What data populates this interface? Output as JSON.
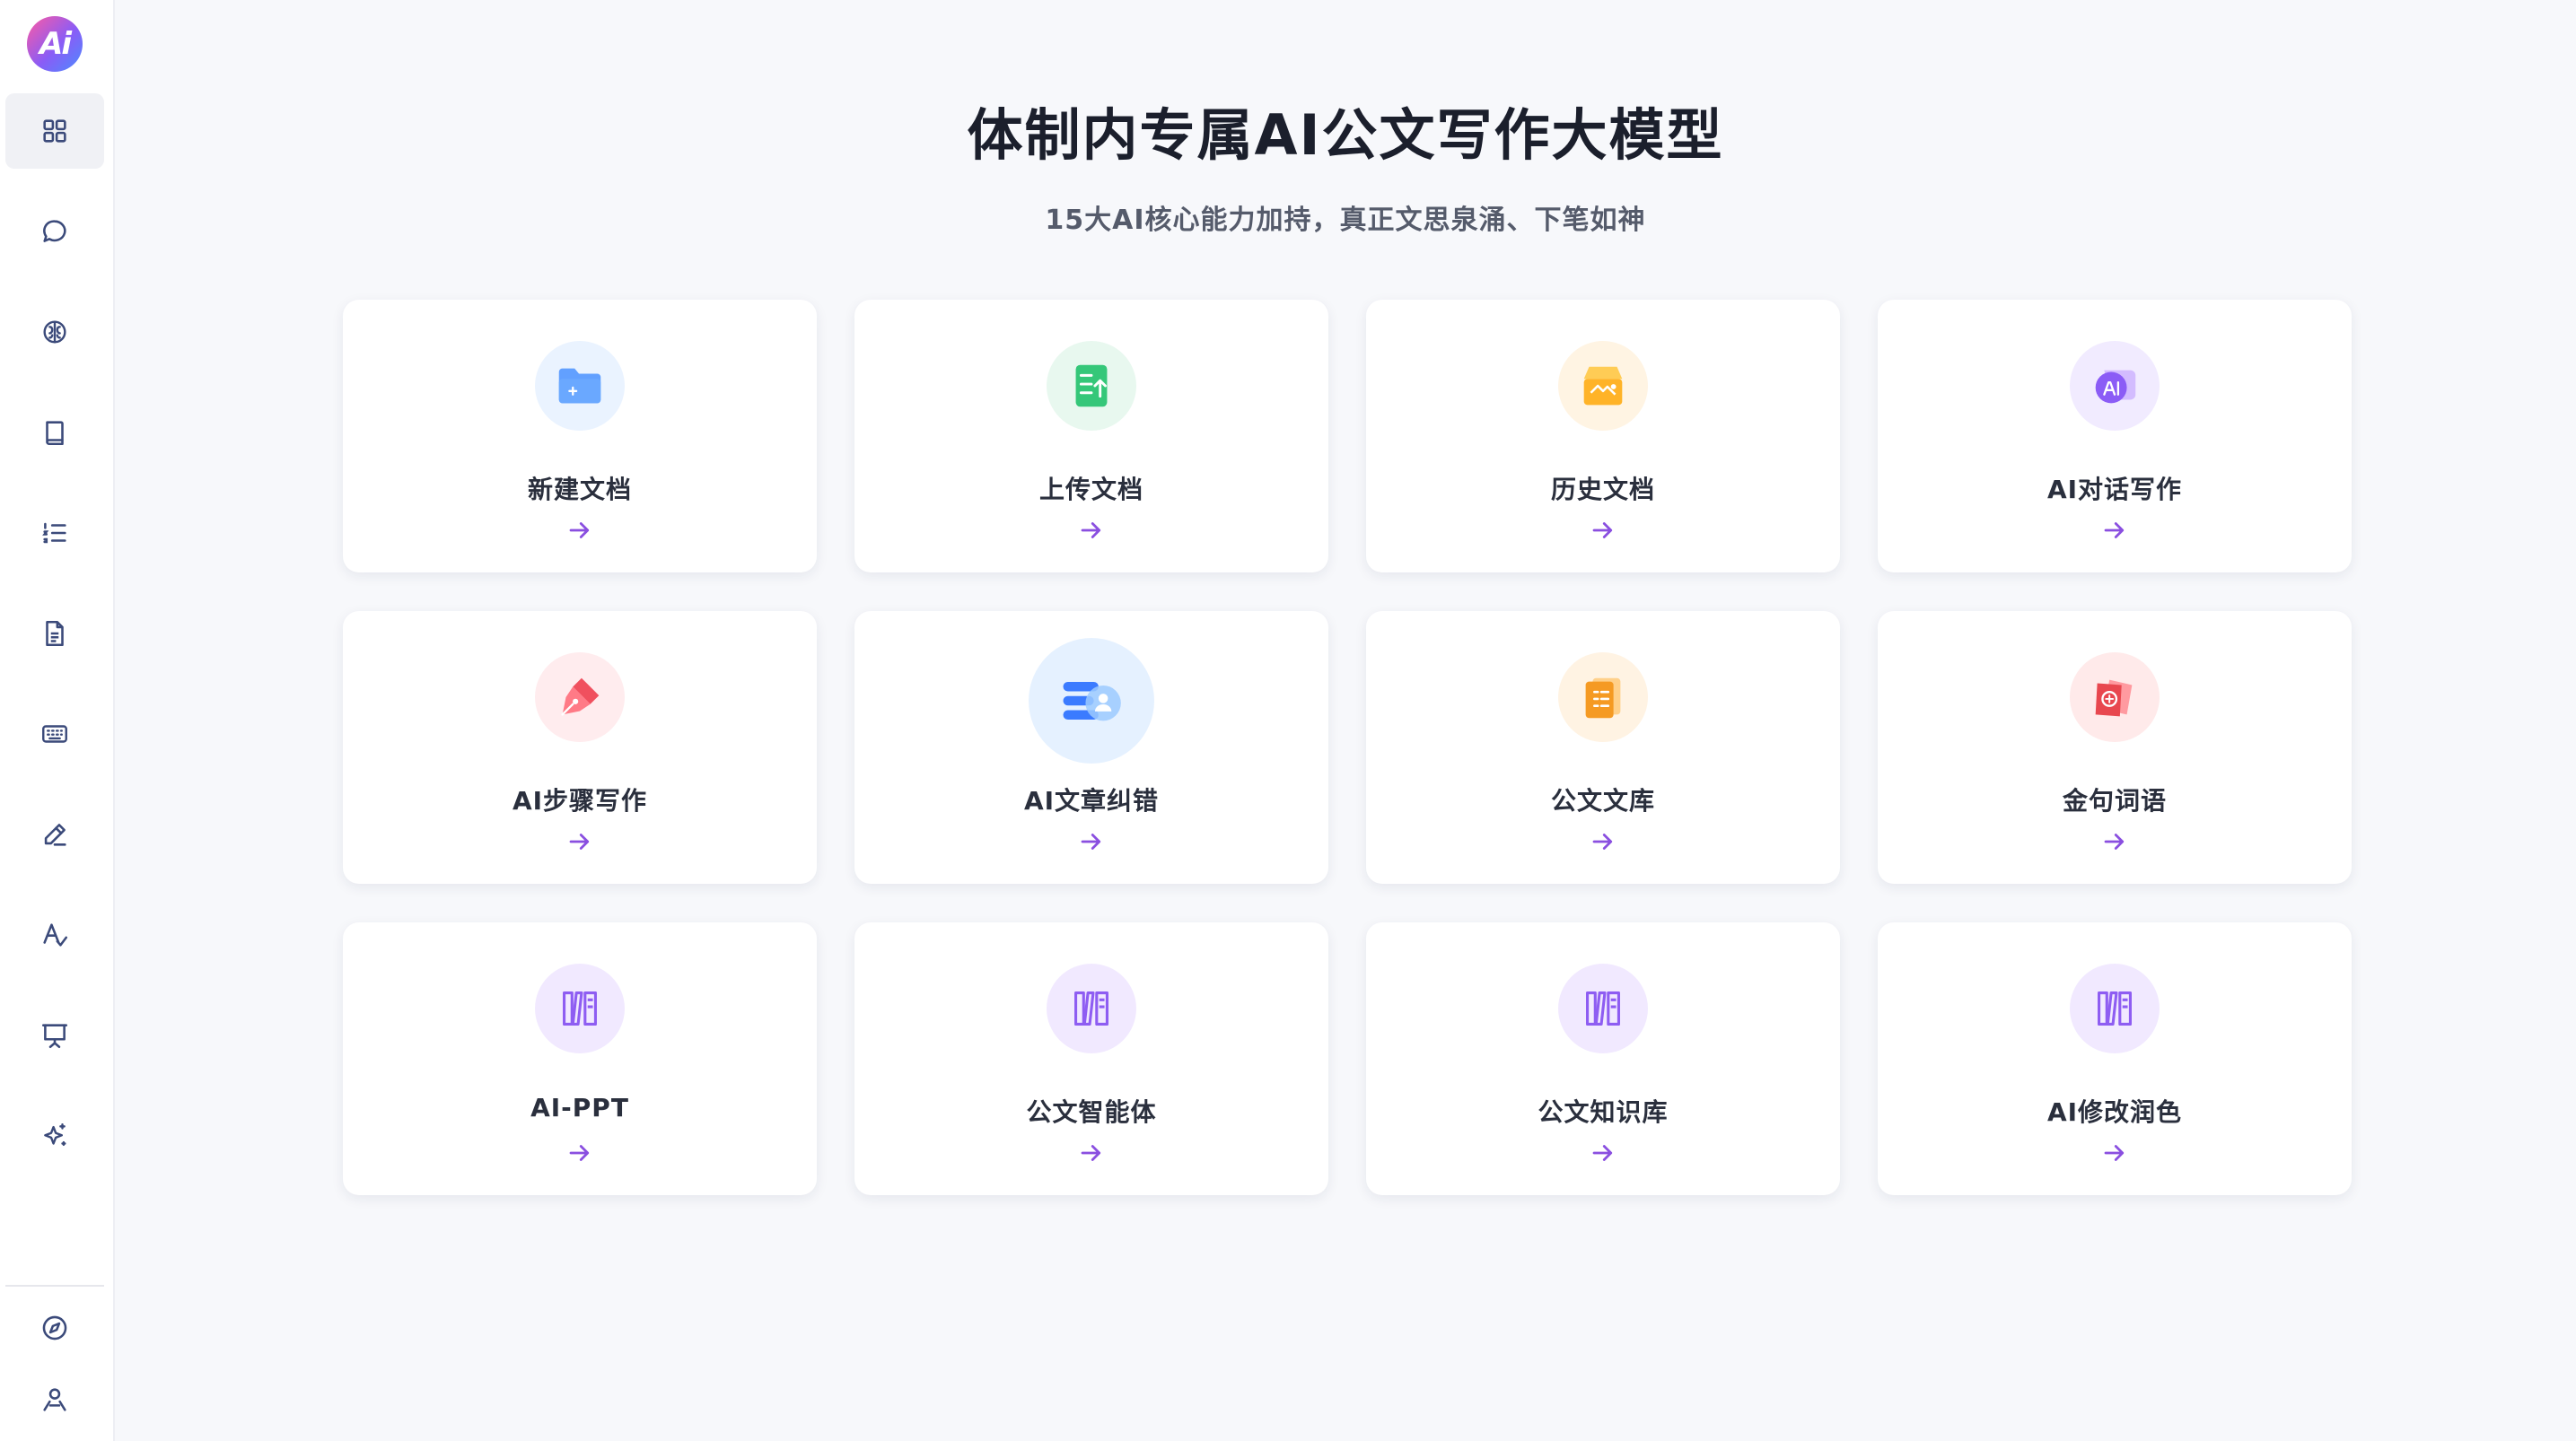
{
  "header": {
    "title": "体制内专属AI公文写作大模型",
    "subtitle": "15大AI核心能力加持，真正文思泉涌、下笔如神"
  },
  "sidebar": {
    "logo_text": "Ai",
    "items": [
      {
        "icon": "grid-icon",
        "active": true
      },
      {
        "icon": "chat-icon"
      },
      {
        "icon": "brain-icon"
      },
      {
        "icon": "book-icon"
      },
      {
        "icon": "list-icon"
      },
      {
        "icon": "document-icon"
      },
      {
        "icon": "keyboard-icon"
      },
      {
        "icon": "pen-icon"
      },
      {
        "icon": "text-style-icon"
      },
      {
        "icon": "presentation-icon"
      },
      {
        "icon": "sparkle-icon"
      }
    ],
    "bottom_items": [
      {
        "icon": "compass-icon"
      },
      {
        "icon": "user-icon"
      }
    ]
  },
  "cards": [
    {
      "label": "新建文档",
      "icon": "new-folder-icon",
      "color": "#3d8bff",
      "bg": "#eaf3ff"
    },
    {
      "label": "上传文档",
      "icon": "upload-document-icon",
      "color": "#2fbf71",
      "bg": "#e8f8ef"
    },
    {
      "label": "历史文档",
      "icon": "history-box-icon",
      "color": "#ffb020",
      "bg": "#fff4e3"
    },
    {
      "label": "AI对话写作",
      "icon": "ai-chat-icon",
      "color": "#8b5cf6",
      "bg": "#f1ebff"
    },
    {
      "label": "AI步骤写作",
      "icon": "pen-nib-icon",
      "color": "#f0505e",
      "bg": "#ffecee"
    },
    {
      "label": "AI文章纠错",
      "icon": "correction-icon",
      "color": "#3b7bff",
      "bg": "#e5f1ff"
    },
    {
      "label": "公文文库",
      "icon": "library-book-icon",
      "color": "#f59a23",
      "bg": "#fff3e3"
    },
    {
      "label": "金句词语",
      "icon": "golden-sentence-icon",
      "color": "#e8474f",
      "bg": "#ffeaea"
    },
    {
      "label": "AI-PPT",
      "icon": "columns-icon",
      "color": "#8e5df2",
      "bg": "#f1e9ff"
    },
    {
      "label": "公文智能体",
      "icon": "columns-icon",
      "color": "#8e5df2",
      "bg": "#f1e9ff"
    },
    {
      "label": "公文知识库",
      "icon": "columns-icon",
      "color": "#8e5df2",
      "bg": "#f1e9ff"
    },
    {
      "label": "AI修改润色",
      "icon": "columns-icon",
      "color": "#8e5df2",
      "bg": "#f1e9ff"
    }
  ],
  "theme": {
    "arrow_color": "#8a4fe0",
    "sidebar_icon_color": "#3b4a7a"
  }
}
